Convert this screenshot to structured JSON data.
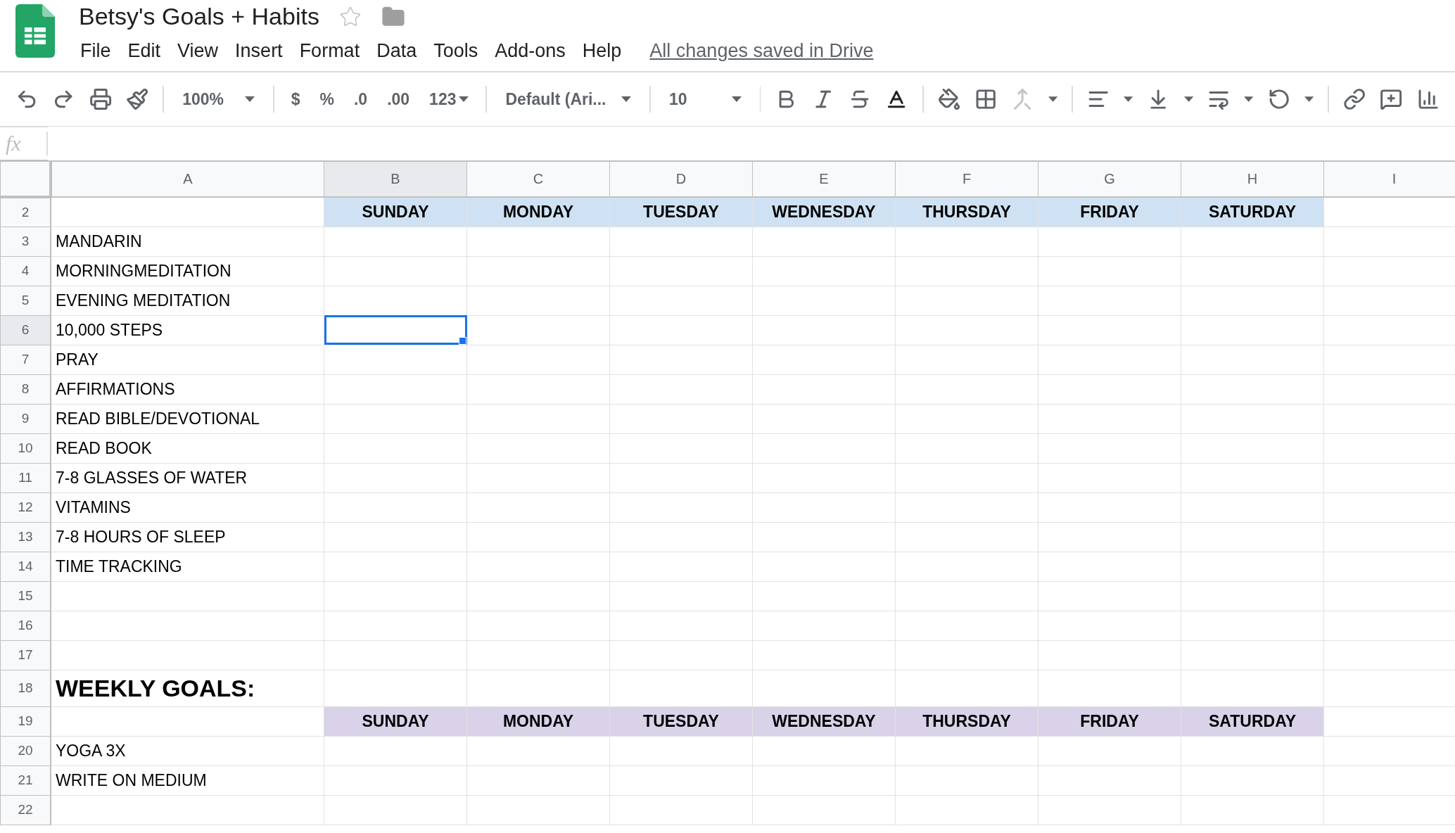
{
  "document": {
    "title": "Betsy's Goals + Habits",
    "starred": false
  },
  "menu": [
    "File",
    "Edit",
    "View",
    "Insert",
    "Format",
    "Data",
    "Tools",
    "Add-ons",
    "Help"
  ],
  "save_status": "All changes saved in Drive",
  "toolbar": {
    "zoom": "100%",
    "currency": "$",
    "percent": "%",
    "decrease_decimals": ".0",
    "increase_decimals": ".00",
    "more_formats": "123",
    "font": "Default (Ari...",
    "font_size": "10"
  },
  "formula_bar": {
    "label": "fx"
  },
  "columns": [
    {
      "label": "A",
      "selected": false
    },
    {
      "label": "B",
      "selected": true
    },
    {
      "label": "C",
      "selected": false
    },
    {
      "label": "D",
      "selected": false
    },
    {
      "label": "E",
      "selected": false
    },
    {
      "label": "F",
      "selected": false
    },
    {
      "label": "G",
      "selected": false
    },
    {
      "label": "H",
      "selected": false
    },
    {
      "label": "I",
      "selected": false
    }
  ],
  "rows": [
    {
      "number": "2",
      "kind": "days",
      "selected": false,
      "color": "#cfe2f3",
      "cells": [
        "SUNDAY",
        "MONDAY",
        "TUESDAY",
        "WEDNESDAY",
        "THURSDAY",
        "FRIDAY",
        "SATURDAY"
      ]
    },
    {
      "number": "3",
      "kind": "item",
      "selected": false,
      "label": "MANDARIN"
    },
    {
      "number": "4",
      "kind": "item",
      "selected": false,
      "label": "MORNINGMEDITATION"
    },
    {
      "number": "5",
      "kind": "item",
      "selected": false,
      "label": "EVENING MEDITATION"
    },
    {
      "number": "6",
      "kind": "item",
      "selected": true,
      "label": "10,000 STEPS"
    },
    {
      "number": "7",
      "kind": "item",
      "selected": false,
      "label": "PRAY"
    },
    {
      "number": "8",
      "kind": "item",
      "selected": false,
      "label": "AFFIRMATIONS"
    },
    {
      "number": "9",
      "kind": "item",
      "selected": false,
      "label": "READ BIBLE/DEVOTIONAL"
    },
    {
      "number": "10",
      "kind": "item",
      "selected": false,
      "label": "READ BOOK"
    },
    {
      "number": "11",
      "kind": "item",
      "selected": false,
      "label": "7-8 GLASSES OF WATER"
    },
    {
      "number": "12",
      "kind": "item",
      "selected": false,
      "label": "VITAMINS"
    },
    {
      "number": "13",
      "kind": "item",
      "selected": false,
      "label": "7-8 HOURS OF SLEEP"
    },
    {
      "number": "14",
      "kind": "item",
      "selected": false,
      "label": "TIME TRACKING"
    },
    {
      "number": "15",
      "kind": "item",
      "selected": false
    },
    {
      "number": "16",
      "kind": "item",
      "selected": false
    },
    {
      "number": "17",
      "kind": "item",
      "selected": false
    },
    {
      "number": "18",
      "kind": "heading",
      "selected": false,
      "label": "WEEKLY GOALS:"
    },
    {
      "number": "19",
      "kind": "days",
      "selected": false,
      "color": "#d9d2e9",
      "cells": [
        "SUNDAY",
        "MONDAY",
        "TUESDAY",
        "WEDNESDAY",
        "THURSDAY",
        "FRIDAY",
        "SATURDAY"
      ]
    },
    {
      "number": "20",
      "kind": "item",
      "selected": false,
      "label": "YOGA 3X"
    },
    {
      "number": "21",
      "kind": "item",
      "selected": false,
      "label": "WRITE ON MEDIUM"
    },
    {
      "number": "22",
      "kind": "item",
      "selected": false
    }
  ]
}
